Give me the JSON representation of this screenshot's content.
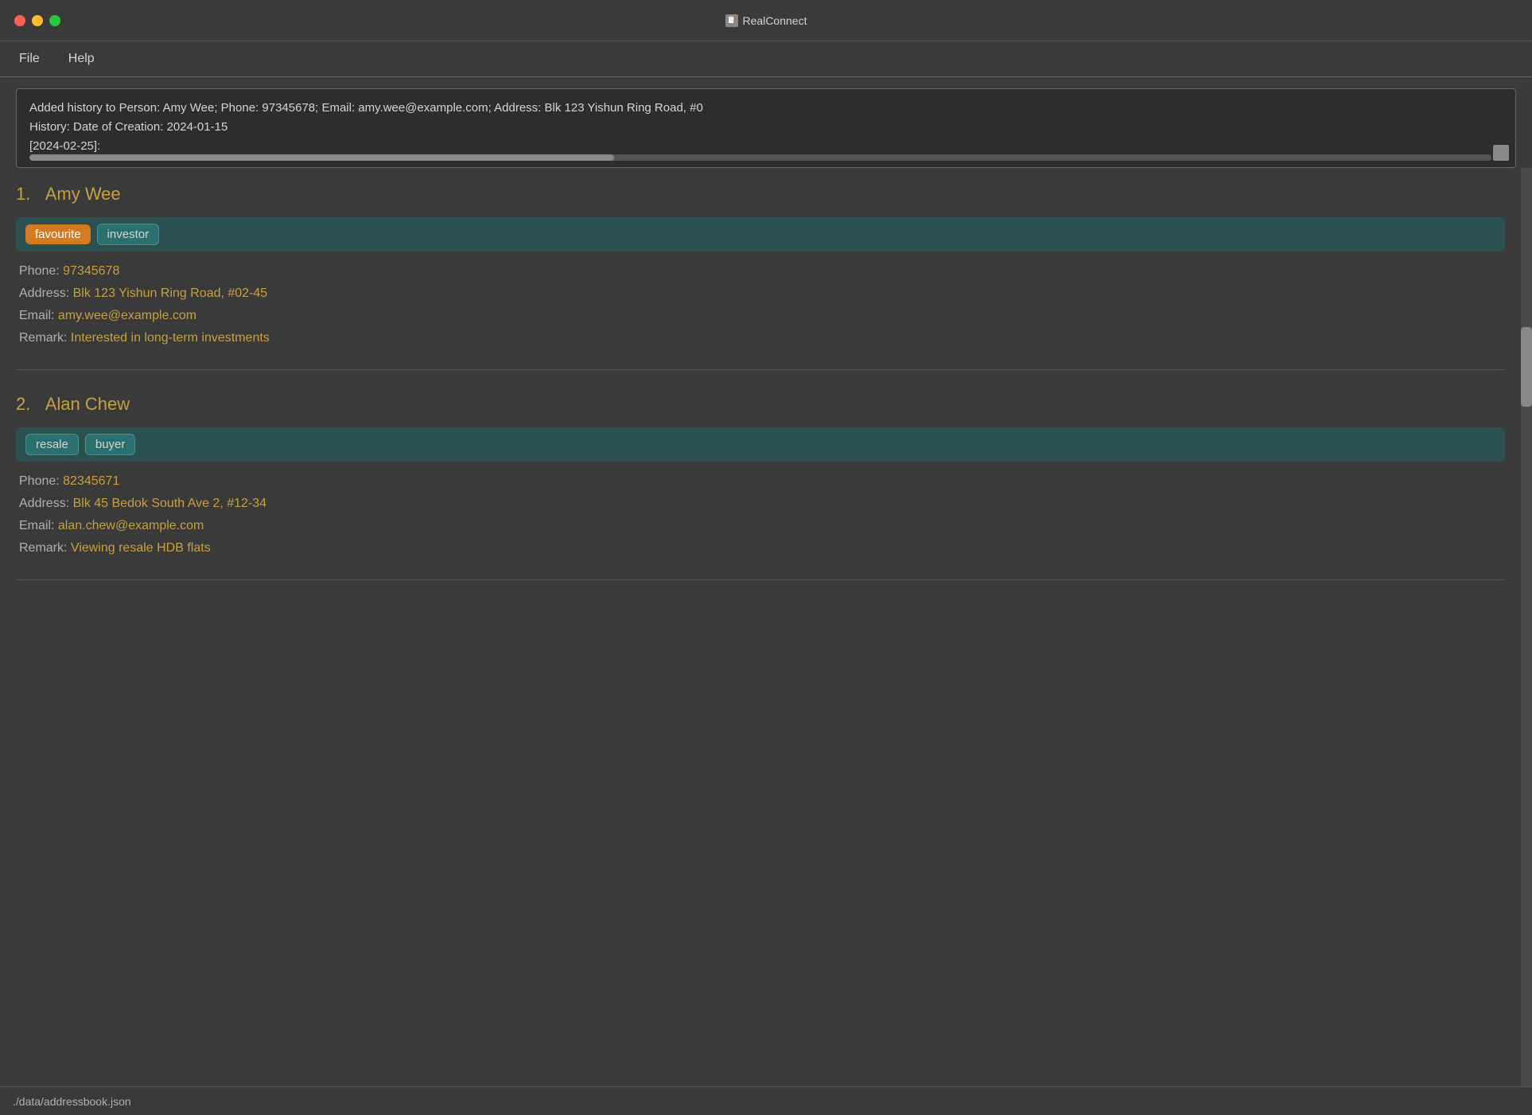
{
  "window": {
    "title": "RealConnect",
    "icon": "R"
  },
  "menu": {
    "items": [
      {
        "label": "File"
      },
      {
        "label": "Help"
      }
    ]
  },
  "command_output": {
    "text_lines": [
      "Added history to Person: Amy Wee; Phone: 97345678; Email: amy.wee@example.com; Address: Blk 123 Yishun Ring Road, #0",
      "History: Date of Creation: 2024-01-15",
      "[2024-02-25]:"
    ]
  },
  "persons": [
    {
      "number": "1.",
      "name": "Amy Wee",
      "tags": [
        {
          "label": "favourite",
          "style": "favourite"
        },
        {
          "label": "investor",
          "style": "investor"
        }
      ],
      "phone_label": "Phone:",
      "phone": "97345678",
      "address_label": "Address:",
      "address": "Blk 123 Yishun Ring Road, #02-45",
      "email_label": "Email:",
      "email": "amy.wee@example.com",
      "remark_label": "Remark:",
      "remark": "Interested in long-term investments"
    },
    {
      "number": "2.",
      "name": "Alan Chew",
      "tags": [
        {
          "label": "resale",
          "style": "resale"
        },
        {
          "label": "buyer",
          "style": "buyer"
        }
      ],
      "phone_label": "Phone:",
      "phone": "82345671",
      "address_label": "Address:",
      "address": "Blk 45 Bedok South Ave 2, #12-34",
      "email_label": "Email:",
      "email": "alan.chew@example.com",
      "remark_label": "Remark:",
      "remark": "Viewing resale HDB flats"
    }
  ],
  "status_bar": {
    "text": "./data/addressbook.json"
  }
}
